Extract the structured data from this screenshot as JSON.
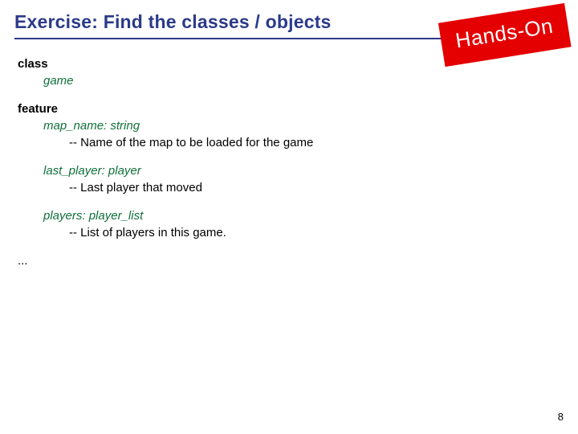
{
  "title": "Exercise: Find the classes / objects",
  "badge": "Hands-On",
  "code": {
    "kw_class": "class",
    "class_name": "game",
    "kw_feature": "feature",
    "attrs": [
      {
        "name": "map_name",
        "type": "string",
        "comment": "-- Name of the map to be loaded for the game"
      },
      {
        "name": "last_player",
        "type": "player",
        "comment": "-- Last player that moved"
      },
      {
        "name": "players",
        "type": "player_list",
        "comment": "-- List of players in this game."
      }
    ],
    "ellipsis": "..."
  },
  "page_number": "8"
}
